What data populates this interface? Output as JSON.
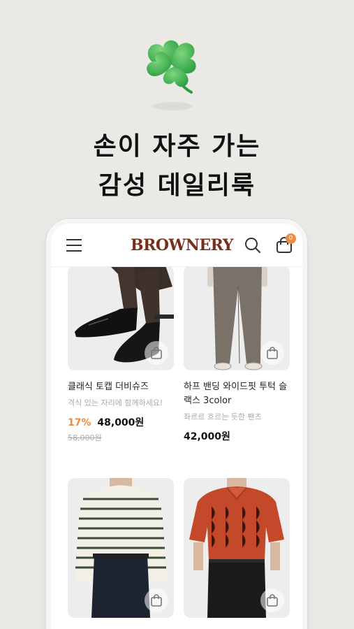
{
  "hero": {
    "line1": "손이 자주 가는",
    "line2": "감성 데일리룩"
  },
  "app": {
    "logo": "BROWNERY",
    "cart_count": "0",
    "brand_color": "#7a2f1d",
    "accent_color": "#f08a3c"
  },
  "products": [
    {
      "name": "클래식 토캡 더비슈즈",
      "desc": "격식 있는 자리에 함께하세요!",
      "discount": "17%",
      "price": "48,000원",
      "original_price": "58,000원",
      "image": "black leather derby shoes"
    },
    {
      "name": "하프 밴딩 와이드핏 투턱 슬랙스 3color",
      "desc": "좌르르 흐르는 듯한 팬츠",
      "price": "42,000원",
      "image": "brown wide slacks"
    },
    {
      "image": "striped knit sweater"
    },
    {
      "image": "orange knit polo shirt"
    }
  ]
}
